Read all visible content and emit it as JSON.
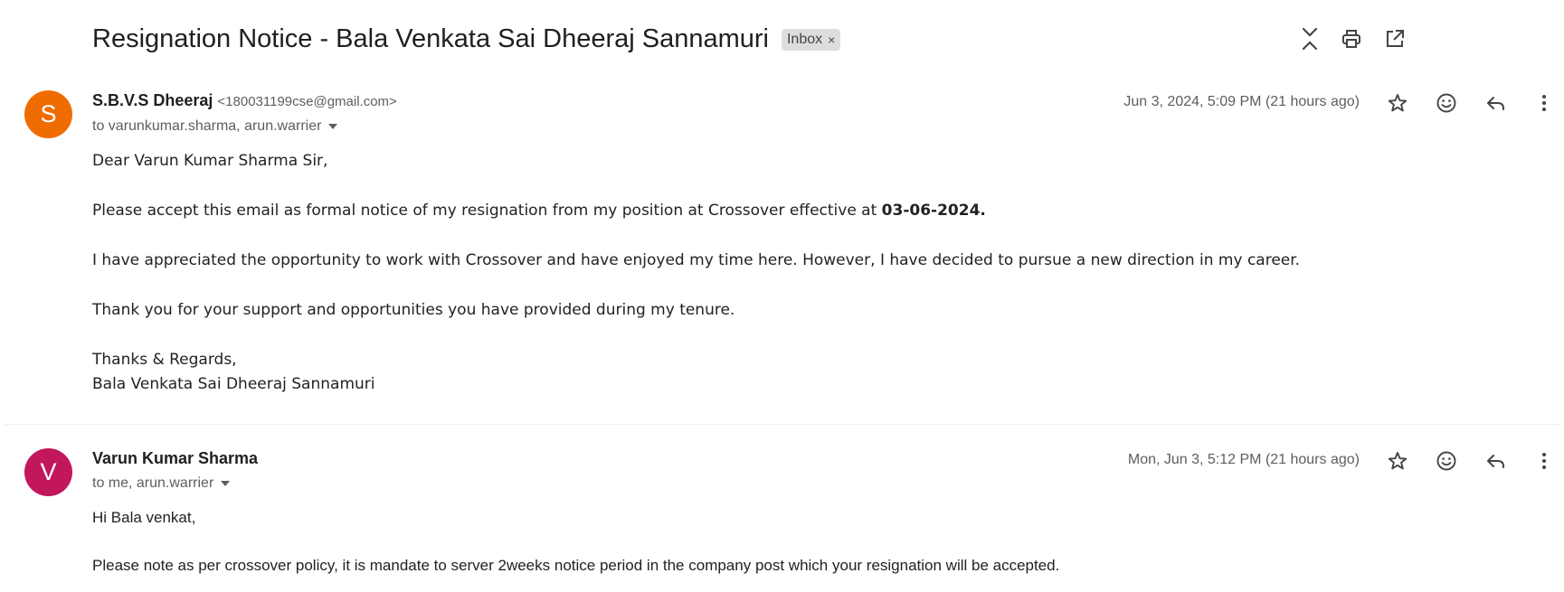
{
  "thread": {
    "subject": "Resignation Notice - Bala Venkata Sai Dheeraj Sannamuri",
    "label": "Inbox",
    "label_remove": "×"
  },
  "toolbar": {
    "icons": [
      "collapse-all-icon",
      "print-icon",
      "open-new-window-icon"
    ]
  },
  "messages": [
    {
      "avatar_letter": "S",
      "avatar_color": "#ef6c00",
      "sender_name": "S.B.V.S Dheeraj",
      "sender_email": "<180031199cse@gmail.com>",
      "to": "to varunkumar.sharma, arun.warrier",
      "date": "Jun 3, 2024, 5:09 PM (21 hours ago)",
      "body": {
        "greeting": "Dear Varun Kumar Sharma Sir,",
        "p1": "Please accept this email as formal notice of my resignation from my position at Crossover effective at ",
        "p1_bold": "03-06-2024.",
        "p2": "I have appreciated the opportunity to work with Crossover and have enjoyed my time here. However, I have decided to pursue a new direction in my career.",
        "p3": "Thank you for your support and opportunities you have provided during my tenure.",
        "closing": "Thanks & Regards,",
        "signature": "Bala Venkata Sai Dheeraj Sannamuri"
      }
    },
    {
      "avatar_letter": "V",
      "avatar_color": "#c2185b",
      "sender_name": "Varun Kumar Sharma",
      "to": "to me, arun.warrier",
      "date": "Mon, Jun 3, 5:12 PM (21 hours ago)",
      "body": {
        "greeting": "Hi Bala venkat,",
        "p1": "Please note as per crossover policy, it is mandate to server 2weeks notice period in the company post which your resignation will be accepted."
      }
    }
  ],
  "message_actions": [
    "star-icon",
    "emoji-reaction-icon",
    "reply-icon",
    "more-options-icon"
  ]
}
